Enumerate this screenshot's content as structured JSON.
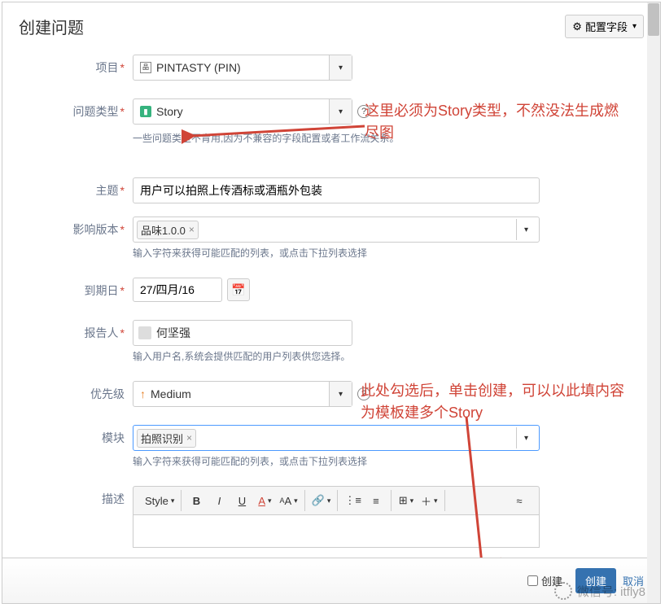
{
  "header": {
    "title": "创建问题",
    "config_button": "配置字段"
  },
  "form": {
    "project": {
      "label": "项目",
      "value": "PINTASTY (PIN)"
    },
    "issue_type": {
      "label": "问题类型",
      "value": "Story",
      "hint": "一些问题类型不肯用,因为不兼容的字段配置或者工作流关系。"
    },
    "summary": {
      "label": "主题",
      "value": "用户可以拍照上传酒标或酒瓶外包装"
    },
    "affects_version": {
      "label": "影响版本",
      "tag": "品味1.0.0",
      "hint": "输入字符来获得可能匹配的列表，或点击下拉列表选择"
    },
    "due_date": {
      "label": "到期日",
      "value": "27/四月/16"
    },
    "reporter": {
      "label": "报告人",
      "value": "何坚强",
      "hint": "输入用户名,系统会提供匹配的用户列表供您选择。"
    },
    "priority": {
      "label": "优先级",
      "value": "Medium"
    },
    "module": {
      "label": "模块",
      "tag": "拍照识别",
      "hint": "输入字符来获得可能匹配的列表，或点击下拉列表选择"
    },
    "description": {
      "label": "描述",
      "style_btn": "Style"
    }
  },
  "footer": {
    "checkbox_label": "创建",
    "submit": "创建",
    "cancel": "取消"
  },
  "annotations": {
    "a1": "这里必须为Story类型，不然没法生成燃尽图",
    "a2": "此处勾选后，单击创建，可以以此填内容为模板建多个Story"
  },
  "watermark": "微信号: itfly8"
}
